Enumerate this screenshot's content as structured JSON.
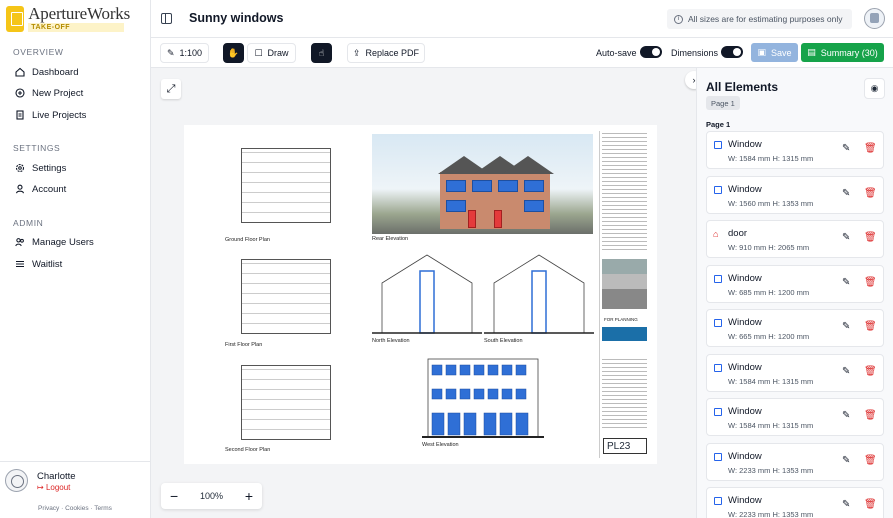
{
  "brand": {
    "name": "ApertureWorks",
    "tagline": "TAKE-OFF"
  },
  "sidebar": {
    "sections": [
      {
        "title": "OVERVIEW",
        "items": [
          {
            "label": "Dashboard",
            "icon": "dashboard-icon"
          },
          {
            "label": "New Project",
            "icon": "plus-circle-icon"
          },
          {
            "label": "Live Projects",
            "icon": "document-icon"
          }
        ]
      },
      {
        "title": "SETTINGS",
        "items": [
          {
            "label": "Settings",
            "icon": "gear-icon"
          },
          {
            "label": "Account",
            "icon": "user-icon"
          }
        ]
      },
      {
        "title": "ADMIN",
        "items": [
          {
            "label": "Manage Users",
            "icon": "users-icon"
          },
          {
            "label": "Waitlist",
            "icon": "list-icon"
          }
        ]
      }
    ],
    "user": {
      "name": "Charlotte",
      "logout": "Logout"
    },
    "footer": "Privacy · Cookies · Terms"
  },
  "header": {
    "title": "Sunny windows",
    "notice": "All sizes are for estimating purposes only"
  },
  "toolbar": {
    "scale": "1:100",
    "draw": "Draw",
    "replace_pdf": "Replace PDF",
    "autosave_label": "Auto-save",
    "autosave_on": true,
    "dimensions_label": "Dimensions",
    "dimensions_on": true,
    "save": "Save",
    "summary": "Summary (30)"
  },
  "canvas": {
    "zoom": "100%",
    "labels": {
      "ground": "Ground Floor Plan",
      "first": "First Floor Plan",
      "second": "Second Floor Plan",
      "rear": "Rear Elevation",
      "north": "North Elevation",
      "south": "South Elevation",
      "west": "West Elevation",
      "planning": "FOR PLANNING",
      "drawing_no": "PL23"
    }
  },
  "panel": {
    "title": "All Elements",
    "page_chip": "Page 1",
    "page_heading": "Page 1",
    "elements": [
      {
        "name": "Window",
        "dims": "W: 1584 mm   H: 1315 mm",
        "type": "window"
      },
      {
        "name": "Window",
        "dims": "W: 1560 mm   H: 1353 mm",
        "type": "window"
      },
      {
        "name": "door",
        "dims": "W: 910 mm   H: 2065 mm",
        "type": "door"
      },
      {
        "name": "Window",
        "dims": "W: 685 mm   H: 1200 mm",
        "type": "window"
      },
      {
        "name": "Window",
        "dims": "W: 665 mm   H: 1200 mm",
        "type": "window"
      },
      {
        "name": "Window",
        "dims": "W: 1584 mm   H: 1315 mm",
        "type": "window"
      },
      {
        "name": "Window",
        "dims": "W: 1584 mm   H: 1315 mm",
        "type": "window"
      },
      {
        "name": "Window",
        "dims": "W: 2233 mm   H: 1353 mm",
        "type": "window"
      },
      {
        "name": "Window",
        "dims": "W: 2233 mm   H: 1353 mm",
        "type": "window"
      }
    ]
  },
  "colors": {
    "accent": "#16a34a",
    "save_disabled": "#93b4de",
    "window_overlay": "#2f6fd6",
    "door_overlay": "#e43b3b",
    "delete": "#dc2626"
  }
}
